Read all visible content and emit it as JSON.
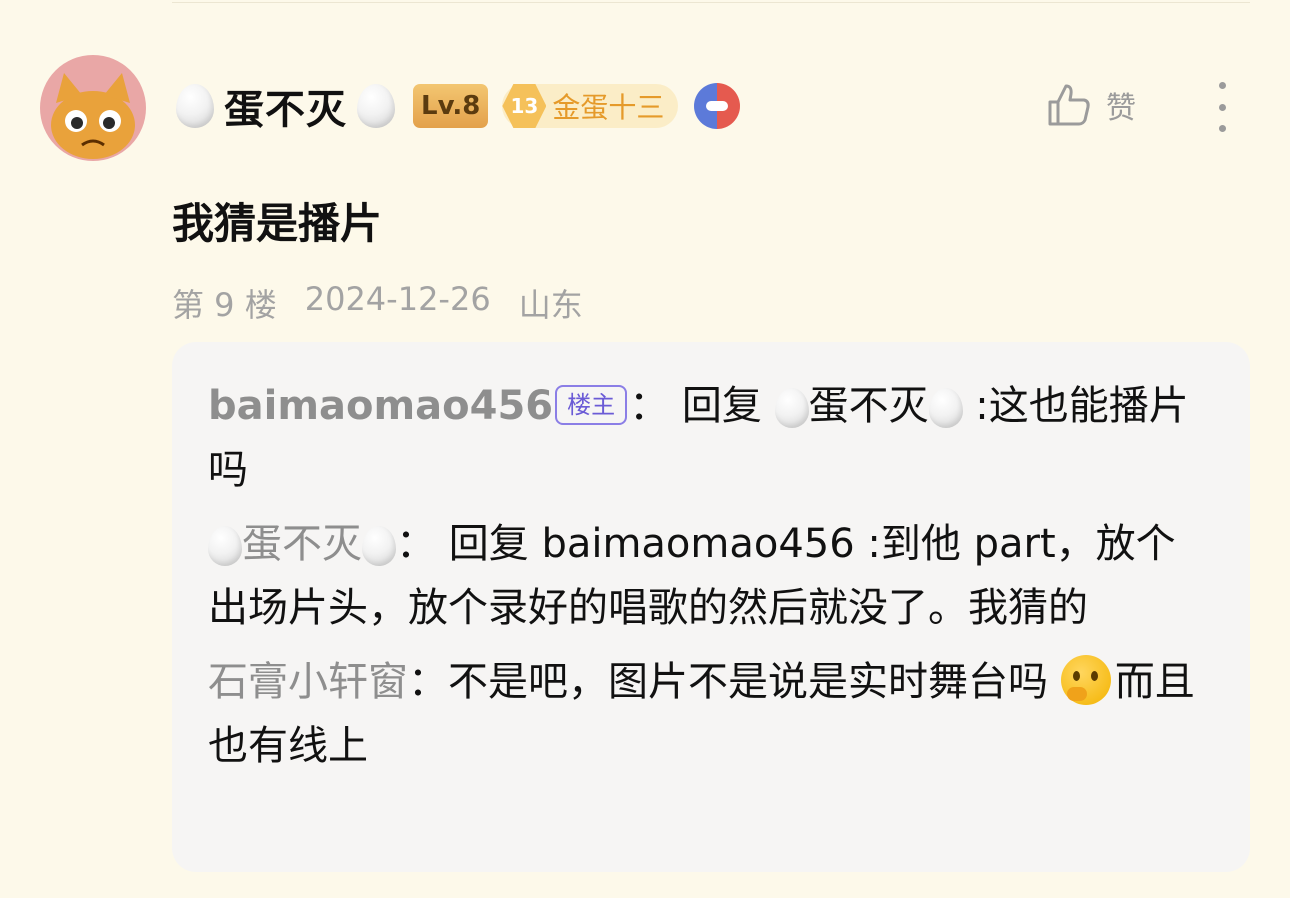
{
  "comment": {
    "author": "蛋不灭",
    "level": "Lv.8",
    "fan_level": "13",
    "fan_title": "金蛋十三",
    "like_label": "赞",
    "content": "我猜是播片",
    "floor": "第 9 楼",
    "date": "2024-12-26",
    "location": "山东"
  },
  "replies": [
    {
      "author": "baimaomao456",
      "badge": "楼主",
      "reply_prefix": "回复",
      "reply_to": "蛋不灭",
      "text": ":这也能播片吗"
    },
    {
      "author": "蛋不灭",
      "reply_prefix": "回复",
      "reply_to": "baimaomao456",
      "text": ":到他 part，放个出场片头，放个录好的唱歌的然后就没了。我猜的"
    },
    {
      "author": "石膏小轩窗",
      "text": "不是吧，图片不是说是实时舞台吗",
      "emoji": "thinking-face-icon",
      "text2": "而且也有线上"
    }
  ],
  "colors": {
    "background": "#fdf9ea",
    "reply_box": "#f6f5f4",
    "host_badge": "#6b5bd6"
  }
}
